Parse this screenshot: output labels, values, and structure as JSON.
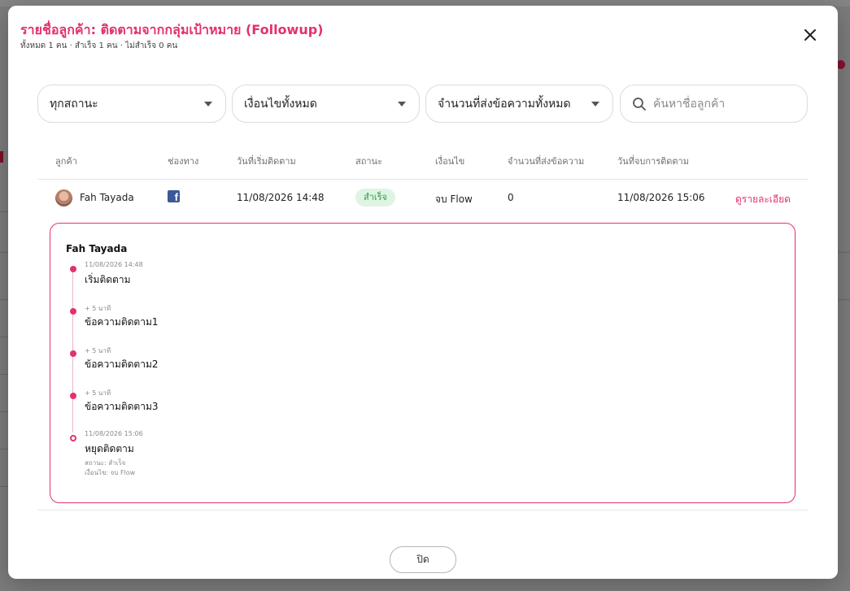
{
  "modal": {
    "title": "รายชื่อลูกค้า: ติดตามจากกลุ่มเป้าหมาย (Followup)",
    "subtitle": "ทั้งหมด 1 คน · สำเร็จ 1 คน · ไม่สำเร็จ 0 คน",
    "close_icon": "close-icon",
    "footer_close_label": "ปิด"
  },
  "filters": {
    "status": "ทุกสถานะ",
    "condition": "เงื่อนไขทั้งหมด",
    "message_count": "จำนวนที่ส่งข้อความทั้งหมด",
    "search_placeholder": "ค้นหาชื่อลูกค้า",
    "search_icon": "search-icon",
    "caret_icon": "caret-down-icon"
  },
  "table": {
    "headers": [
      "ลูกค้า",
      "ช่องทาง",
      "วันที่เริ่มติดตาม",
      "สถานะ",
      "เงื่อนไข",
      "จำนวนที่ส่งข้อความ",
      "วันที่จบการติดตาม"
    ],
    "rows": [
      {
        "customer": "Fah Tayada",
        "channel_icon": "facebook-icon",
        "start_date": "11/08/2026 14:48",
        "status": "สำเร็จ",
        "condition": "จบ Flow",
        "message_count": "0",
        "end_date": "11/08/2026 15:06",
        "action": "ดูรายละเอียด"
      }
    ]
  },
  "detail": {
    "name": "Fah Tayada",
    "timeline": [
      {
        "time": "11/08/2026 14:48",
        "title": "เริ่มติดตาม"
      },
      {
        "time": "+ 5 นาที",
        "title": "ข้อความติดตาม1"
      },
      {
        "time": "+ 5 นาที",
        "title": "ข้อความติดตาม2"
      },
      {
        "time": "+ 5 นาที",
        "title": "ข้อความติดตาม3"
      },
      {
        "time": "11/08/2026 15:06",
        "title": "หยุดติดตาม",
        "status_line": "สถานะ: สำเร็จ",
        "condition_line": "เงื่อนไข: จบ Flow"
      }
    ]
  },
  "colors": {
    "accent": "#e3316e",
    "success_bg": "#dff4e3",
    "success_text": "#2f9a4b",
    "facebook": "#3b5998"
  }
}
